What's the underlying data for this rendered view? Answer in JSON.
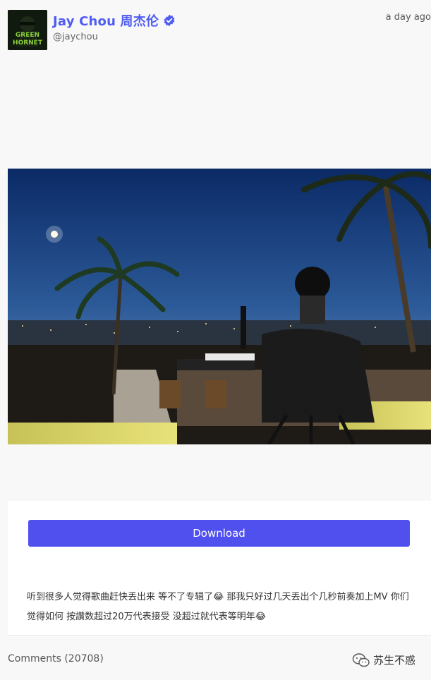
{
  "post": {
    "author_name": "Jay Chou 周杰伦",
    "handle": "@jaychou",
    "time": "a day ago",
    "avatar_text_1": "GREEN",
    "avatar_text_2": "HORNET",
    "download_label": "Download",
    "caption": "听到很多人觉得歌曲赶快丢出来 等不了专辑了😂 那我只好过几天丢出个几秒前奏加上MV 你们觉得如何 按讚数超过20万代表接受 没超过就代表等明年😂"
  },
  "footer": {
    "comments_label": "Comments (20708)",
    "watermark_text": "苏生不惑"
  },
  "colors": {
    "accent": "#4f5cf2",
    "button": "#5050ef",
    "background": "#f8f8f8"
  },
  "icons": [
    "verified-badge-icon",
    "wechat-icon"
  ]
}
